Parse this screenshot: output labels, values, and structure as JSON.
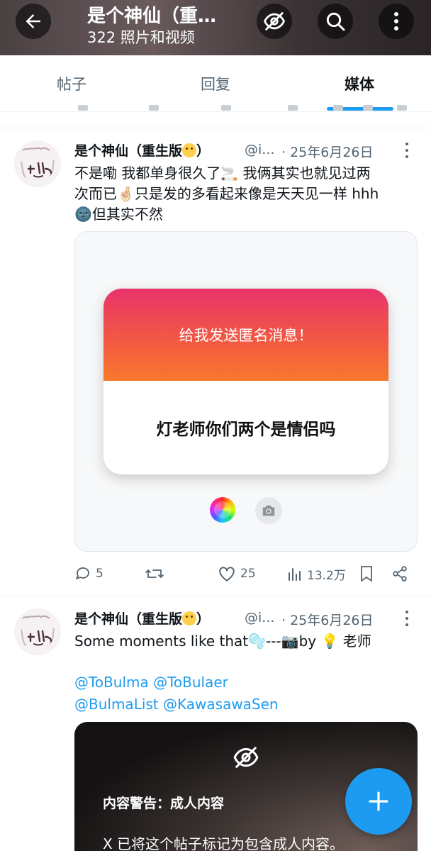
{
  "header": {
    "title": "是个神仙（重…",
    "subtitle": "322 照片和视频"
  },
  "tabs": [
    {
      "label": "帖子",
      "active": false
    },
    {
      "label": "回复",
      "active": false
    },
    {
      "label": "媒体",
      "active": true
    }
  ],
  "posts": [
    {
      "name": "是个神仙（重生版",
      "name_close": "）",
      "handle": "@i...",
      "date": "· 25年6月26日",
      "text_lines": [
        "不是嘞 我都单身很久了🚬 我俩其实也就见过两",
        "次而已🤞🏻只是发的多看起来像是天天见一样 hhh",
        "🌚但其实不然"
      ],
      "media": {
        "card_header": "给我发送匿名消息！",
        "card_body": "灯老师你们两个是情侣吗"
      },
      "stats": {
        "replies": "5",
        "reposts": "",
        "likes": "25",
        "views": "13.2万"
      }
    },
    {
      "name": "是个神仙（重生版",
      "name_close": "）",
      "handle": "@i...",
      "date": "· 25年6月26日",
      "text_line": "Some moments like that🫧---📷by 💡 老师",
      "mentions": [
        "@ToBulma @ToBulaer",
        "@BulmaList @KawasawaSen"
      ],
      "warning": {
        "title": "内容警告：成人内容",
        "text": "X 已将这个帖子标记为包含成人内容。"
      }
    }
  ],
  "colors": {
    "accent": "#1d9bf0",
    "text_secondary": "#536471"
  }
}
